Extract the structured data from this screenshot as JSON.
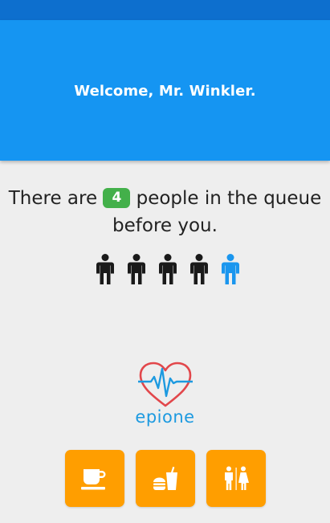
{
  "header": {
    "welcome_text": "Welcome, Mr. Winkler."
  },
  "queue": {
    "text_before": "There are",
    "count": "4",
    "text_after": "people in the queue before you.",
    "people_ahead": 4,
    "you_color": "#1a96ee",
    "others_color": "#1a1a1a"
  },
  "logo": {
    "name": "epione",
    "icon": "heart-pulse-icon"
  },
  "actions": [
    {
      "icon": "coffee-cup-icon"
    },
    {
      "icon": "food-drink-icon"
    },
    {
      "icon": "restroom-icon"
    }
  ],
  "colors": {
    "status_bar": "#0d6fce",
    "header": "#1595f2",
    "badge": "#43b04a",
    "action_button": "#ff9e00",
    "background": "#eeeeee"
  }
}
